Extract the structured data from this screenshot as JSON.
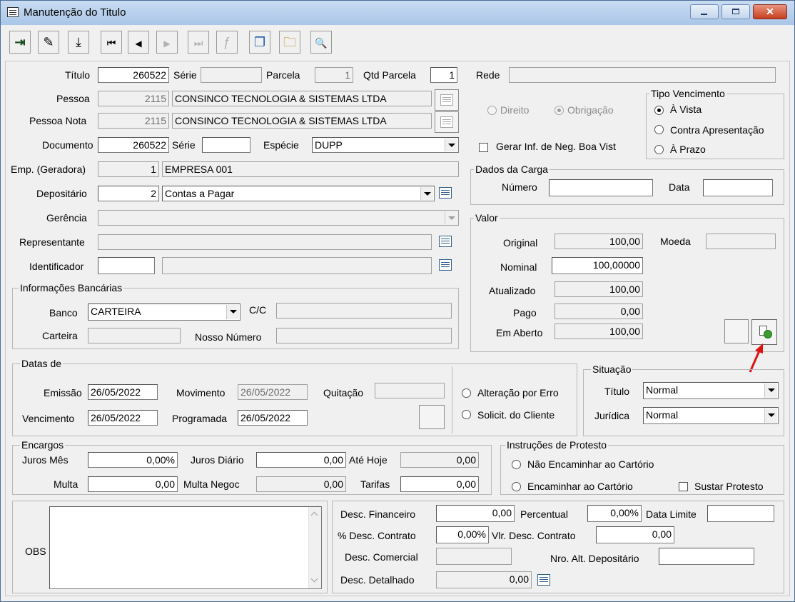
{
  "window": {
    "title": "Manutenção do Titulo"
  },
  "toolbar": {
    "exit": "⇥",
    "edit": "✎",
    "save": "⤓",
    "first": "⏮",
    "prev": "◀",
    "next": "▶",
    "last": "⏭",
    "func": "ƒ",
    "copy": "❐",
    "folder": "🗀",
    "preview": "🔍"
  },
  "header": {
    "titulo_label": "Título",
    "titulo": "260522",
    "serie_label": "Série",
    "serie": "",
    "parcela_label": "Parcela",
    "parcela": "1",
    "qtd_parcela_label": "Qtd Parcela",
    "qtd_parcela": "1",
    "rede_label": "Rede",
    "rede": "",
    "pessoa_label": "Pessoa",
    "pessoa_code": "2115",
    "pessoa_name": "CONSINCO TECNOLOGIA & SISTEMAS LTDA",
    "pessoa_nota_label": "Pessoa Nota",
    "pessoa_nota_code": "2115",
    "pessoa_nota_name": "CONSINCO TECNOLOGIA & SISTEMAS LTDA",
    "documento_label": "Documento",
    "documento": "260522",
    "serie2_label": "Série",
    "serie2": "",
    "especie_label": "Espécie",
    "especie": "DUPP",
    "emp_label": "Emp. (Geradora)",
    "emp_code": "1",
    "emp_name": "EMPRESA 001",
    "depositario_label": "Depositário",
    "depositario_code": "2",
    "depositario_name": "Contas a Pagar",
    "gerencia_label": "Gerência",
    "gerencia": "",
    "representante_label": "Representante",
    "representante": "",
    "identificador_label": "Identificador",
    "identificador_code": "",
    "identificador_name": ""
  },
  "tipo": {
    "direito": "Direito",
    "obrigacao": "Obrigação",
    "selected": "Obrigação"
  },
  "tipo_vencimento": {
    "title": "Tipo Vencimento",
    "options": [
      "À Vista",
      "Contra Apresentação",
      "À Prazo"
    ],
    "selected": "À Vista"
  },
  "gerar_inf": {
    "label": "Gerar Inf. de Neg. Boa Vist",
    "checked": false
  },
  "dados_carga": {
    "title": "Dados da Carga",
    "numero_label": "Número",
    "numero": "",
    "data_label": "Data",
    "data": ""
  },
  "valor": {
    "title": "Valor",
    "original_label": "Original",
    "original": "100,00",
    "moeda_label": "Moeda",
    "moeda": "",
    "nominal_label": "Nominal",
    "nominal": "100,00000",
    "atualizado_label": "Atualizado",
    "atualizado": "100,00",
    "pago_label": "Pago",
    "pago": "0,00",
    "em_aberto_label": "Em Aberto",
    "em_aberto": "100,00"
  },
  "banco": {
    "title": "Informações Bancárias",
    "banco_label": "Banco",
    "banco": "CARTEIRA",
    "cc_label": "C/C",
    "cc": "",
    "carteira_label": "Carteira",
    "carteira": "",
    "nosso_numero_label": "Nosso Número",
    "nosso_numero": ""
  },
  "datas": {
    "title": "Datas de",
    "emissao_label": "Emissão",
    "emissao": "26/05/2022",
    "movimento_label": "Movimento",
    "movimento": "26/05/2022",
    "quitacao_label": "Quitação",
    "quitacao": "",
    "vencimento_label": "Vencimento",
    "vencimento": "26/05/2022",
    "programada_label": "Programada",
    "programada": "26/05/2022"
  },
  "alteracao": {
    "por_erro": "Alteração por Erro",
    "solicit_cliente": "Solicit. do Cliente"
  },
  "situacao": {
    "title": "Situação",
    "titulo_label": "Título",
    "titulo": "Normal",
    "juridica_label": "Jurídica",
    "juridica": "Normal"
  },
  "encargos": {
    "title": "Encargos",
    "juros_mes_label": "Juros Mês",
    "juros_mes": "0,00%",
    "juros_diario_label": "Juros Diário",
    "juros_diario": "0,00",
    "ate_hoje_label": "Até Hoje",
    "ate_hoje": "0,00",
    "multa_label": "Multa",
    "multa": "0,00",
    "multa_negoc_label": "Multa Negoc",
    "multa_negoc": "0,00",
    "tarifas_label": "Tarifas",
    "tarifas": "0,00"
  },
  "protesto": {
    "title": "Instruções de Protesto",
    "nao_encaminhar": "Não Encaminhar ao Cartório",
    "encaminhar": "Encaminhar ao Cartório",
    "sustar": "Sustar Protesto"
  },
  "obs": {
    "label": "OBS",
    "text": ""
  },
  "descontos": {
    "financeiro_label": "Desc. Financeiro",
    "financeiro": "0,00",
    "percentual_label": "Percentual",
    "percentual": "0,00%",
    "data_limite_label": "Data Limite",
    "data_limite": "",
    "pct_contrato_label": "% Desc. Contrato",
    "pct_contrato": "0,00%",
    "vlr_contrato_label": "Vlr. Desc. Contrato",
    "vlr_contrato": "0,00",
    "comercial_label": "Desc. Comercial",
    "comercial": "",
    "nro_alt_label": "Nro. Alt. Depositário",
    "nro_alt": "",
    "detalhado_label": "Desc. Detalhado",
    "detalhado": "0,00"
  }
}
